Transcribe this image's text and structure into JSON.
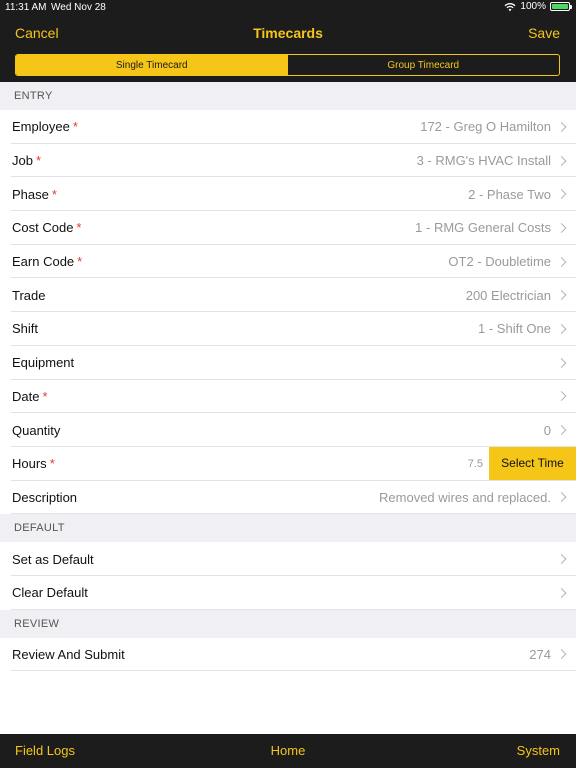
{
  "status_bar": {
    "time": "11:31 AM",
    "date": "Wed Nov 28",
    "battery": "100%"
  },
  "nav": {
    "left": "Cancel",
    "title": "Timecards",
    "right": "Save"
  },
  "segments": [
    {
      "label": "Single Timecard"
    },
    {
      "label": "Group Timecard"
    }
  ],
  "sections": {
    "entry": {
      "header": "ENTRY",
      "rows": [
        {
          "label": "Employee",
          "value": "172 - Greg O Hamilton"
        },
        {
          "label": "Job",
          "value": "3 - RMG's HVAC Install"
        },
        {
          "label": "Phase",
          "value": "2 - Phase Two"
        },
        {
          "label": "Cost Code",
          "value": "1 - RMG General Costs"
        },
        {
          "label": "Earn Code",
          "value": "OT2 - Doubletime"
        },
        {
          "label": "Trade",
          "value": "200 Electrician"
        },
        {
          "label": "Shift",
          "value": "1 - Shift One"
        },
        {
          "label": "Equipment",
          "value": ""
        },
        {
          "label": "Date",
          "value": ""
        },
        {
          "label": "Quantity",
          "value": "0"
        },
        {
          "label": "Hours",
          "value": "7.5",
          "button": "Select Time"
        },
        {
          "label": "Description",
          "value": "Removed wires and replaced."
        }
      ]
    },
    "default": {
      "header": "DEFAULT",
      "rows": [
        {
          "label": "Set as Default"
        },
        {
          "label": "Clear Default"
        }
      ]
    },
    "review": {
      "header": "REVIEW",
      "rows": [
        {
          "label": "Review And Submit",
          "value": "274"
        }
      ]
    }
  },
  "required_marker": "*",
  "tabbar": {
    "left": "Field Logs",
    "center": "Home",
    "right": "System"
  },
  "colors": {
    "accent": "#f5c518",
    "bar_background": "#1c1c1c",
    "required": "#e53935",
    "section_background": "#efeff4"
  }
}
